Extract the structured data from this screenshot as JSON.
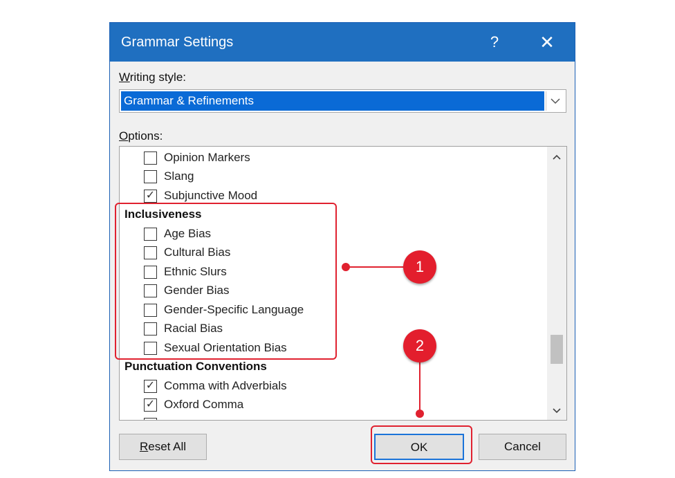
{
  "dialog": {
    "title": "Grammar Settings",
    "help": "?",
    "close": "✕"
  },
  "writing_style": {
    "label_first": "W",
    "label_rest": "riting style:",
    "value": "Grammar & Refinements"
  },
  "options": {
    "label_first": "O",
    "label_rest": "ptions:",
    "items": [
      {
        "label": "Opinion Markers",
        "checked": false
      },
      {
        "label": "Slang",
        "checked": false
      },
      {
        "label": "Subjunctive Mood",
        "checked": true
      }
    ],
    "inclusiveness": {
      "heading": "Inclusiveness",
      "items": [
        {
          "label": "Age Bias",
          "checked": false
        },
        {
          "label": "Cultural Bias",
          "checked": false
        },
        {
          "label": "Ethnic Slurs",
          "checked": false
        },
        {
          "label": "Gender Bias",
          "checked": false
        },
        {
          "label": "Gender-Specific Language",
          "checked": false
        },
        {
          "label": "Racial Bias",
          "checked": false
        },
        {
          "label": "Sexual Orientation Bias",
          "checked": false
        }
      ]
    },
    "punctuation": {
      "heading": "Punctuation Conventions",
      "items": [
        {
          "label": "Comma with Adverbials",
          "checked": true
        },
        {
          "label": "Oxford Comma",
          "checked": true
        }
      ]
    }
  },
  "buttons": {
    "reset_first": "R",
    "reset_rest": "eset All",
    "ok": "OK",
    "cancel": "Cancel"
  },
  "callouts": {
    "one": "1",
    "two": "2"
  },
  "colors": {
    "titlebar": "#1f6fc0",
    "selection": "#0a6ad6",
    "callout_red": "#e31e2d"
  }
}
